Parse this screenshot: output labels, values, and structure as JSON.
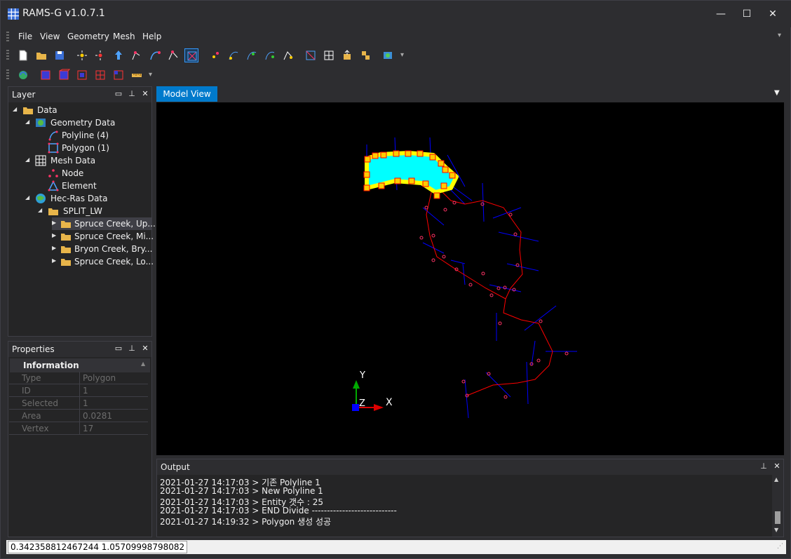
{
  "window": {
    "title": "RAMS-G v1.0.7.1",
    "minimize": "—",
    "maximize": "☐",
    "close": "✕"
  },
  "menu": [
    "File",
    "View",
    "Geometry",
    "Mesh",
    "Help"
  ],
  "layer": {
    "title": "Layer",
    "items": [
      {
        "label": "Data"
      },
      {
        "label": "Geometry Data"
      },
      {
        "label": "Polyline (4)"
      },
      {
        "label": "Polygon (1)"
      },
      {
        "label": "Mesh Data"
      },
      {
        "label": "Node"
      },
      {
        "label": "Element"
      },
      {
        "label": "Hec-Ras Data"
      },
      {
        "label": "SPLIT_LW"
      },
      {
        "label": "Spruce Creek, Up..."
      },
      {
        "label": "Spruce Creek, Mi..."
      },
      {
        "label": "Bryon Creek, Bry..."
      },
      {
        "label": "Spruce Creek, Lo..."
      }
    ]
  },
  "properties": {
    "title": "Properties",
    "section": "Information",
    "rows": [
      {
        "key": "Type",
        "value": "Polygon"
      },
      {
        "key": "ID",
        "value": "1"
      },
      {
        "key": "Selected",
        "value": "1"
      },
      {
        "key": "Area",
        "value": "0.0281"
      },
      {
        "key": "Vertex",
        "value": "17"
      }
    ]
  },
  "model_view": {
    "tab": "Model View",
    "axis_y": "Y",
    "axis_z": "Z",
    "axis_x": "X"
  },
  "output": {
    "title": "Output",
    "lines": [
      "2021-01-27 14:17:03 > 기존 Polyline 1",
      "2021-01-27 14:17:03 > New Polyline 1",
      "2021-01-27 14:17:03 > Entity 갯수 : 25",
      "2021-01-27 14:17:03 > END Divide ----------------------------",
      "2021-01-27 14:19:32 > Polygon 생성 성공"
    ]
  },
  "status": {
    "coords": "0.342358812467244 1.05709998798082"
  },
  "colors": {
    "accent": "#007acc",
    "polygon_fill": "#00ffff",
    "polygon_outline": "#ffff00",
    "river": "#ff0000",
    "cross_section": "#0000ff"
  }
}
